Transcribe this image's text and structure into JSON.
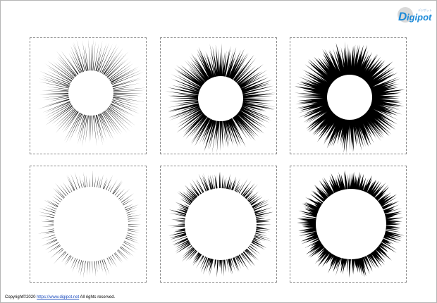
{
  "brand": {
    "name": "Digipot",
    "logo_text": "Digipot",
    "primary_color": "#1d8ad8",
    "accent_color": "#c3c3c3"
  },
  "footer": {
    "copyright": "Copyright©2020",
    "url": "https://www.digipot.net",
    "rights": "All rights reserved."
  },
  "illustrations": [
    {
      "name": "burst-light-small-circle",
      "density": "light",
      "circle": "small"
    },
    {
      "name": "burst-medium-small-circle",
      "density": "medium",
      "circle": "small"
    },
    {
      "name": "burst-heavy-small-circle",
      "density": "heavy",
      "circle": "small"
    },
    {
      "name": "burst-light-large-circle",
      "density": "light",
      "circle": "large"
    },
    {
      "name": "burst-medium-large-circle",
      "density": "medium",
      "circle": "large"
    },
    {
      "name": "burst-heavy-large-circle",
      "density": "heavy",
      "circle": "large"
    }
  ]
}
